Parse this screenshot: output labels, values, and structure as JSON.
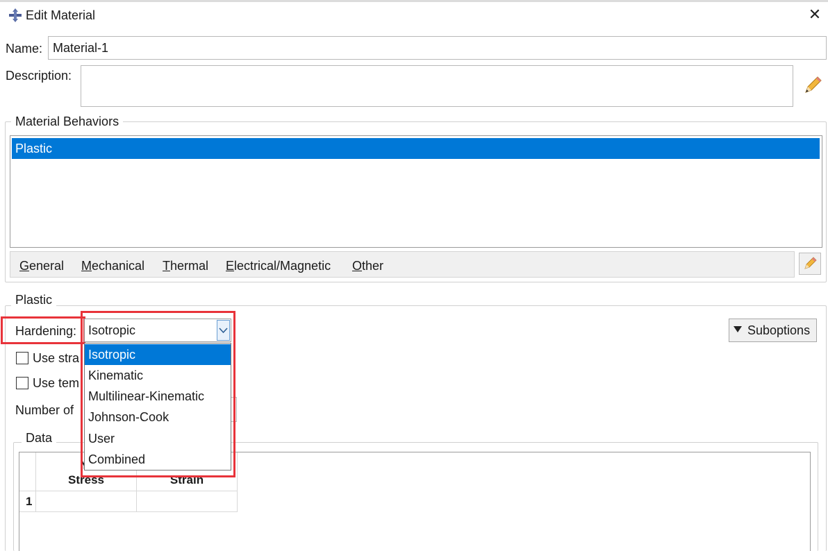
{
  "window": {
    "title": "Edit Material",
    "close_glyph": "✕"
  },
  "name": {
    "label": "Name:",
    "value": "Material-1"
  },
  "description": {
    "label": "Description:",
    "value": ""
  },
  "behaviors": {
    "legend": "Material Behaviors",
    "items": [
      "Plastic"
    ],
    "selected": "Plastic"
  },
  "menu": {
    "items": [
      {
        "first": "G",
        "rest": "eneral"
      },
      {
        "first": "M",
        "rest": "echanical"
      },
      {
        "first": "T",
        "rest": "hermal"
      },
      {
        "first": "E",
        "rest": "lectrical/Magnetic"
      },
      {
        "first": "O",
        "rest": "ther"
      }
    ]
  },
  "plastic": {
    "legend": "Plastic",
    "hardening_label": "Hardening:",
    "hardening_value": "Isotropic",
    "hardening_options": [
      "Isotropic",
      "Kinematic",
      "Multilinear-Kinematic",
      "Johnson-Cook",
      "User",
      "Combined"
    ],
    "suboptions_label": "Suboptions",
    "use_strain_label": "Use stra",
    "use_temp_label": "Use tem",
    "number_of_label": "Number of"
  },
  "data_table": {
    "legend": "Data",
    "col1_top": "Yi",
    "col1_bottom": "Stress",
    "col2_bottom": "Strain",
    "row_number": "1"
  },
  "colors": {
    "selection": "#0078d7",
    "highlight_red": "#e8333a"
  }
}
